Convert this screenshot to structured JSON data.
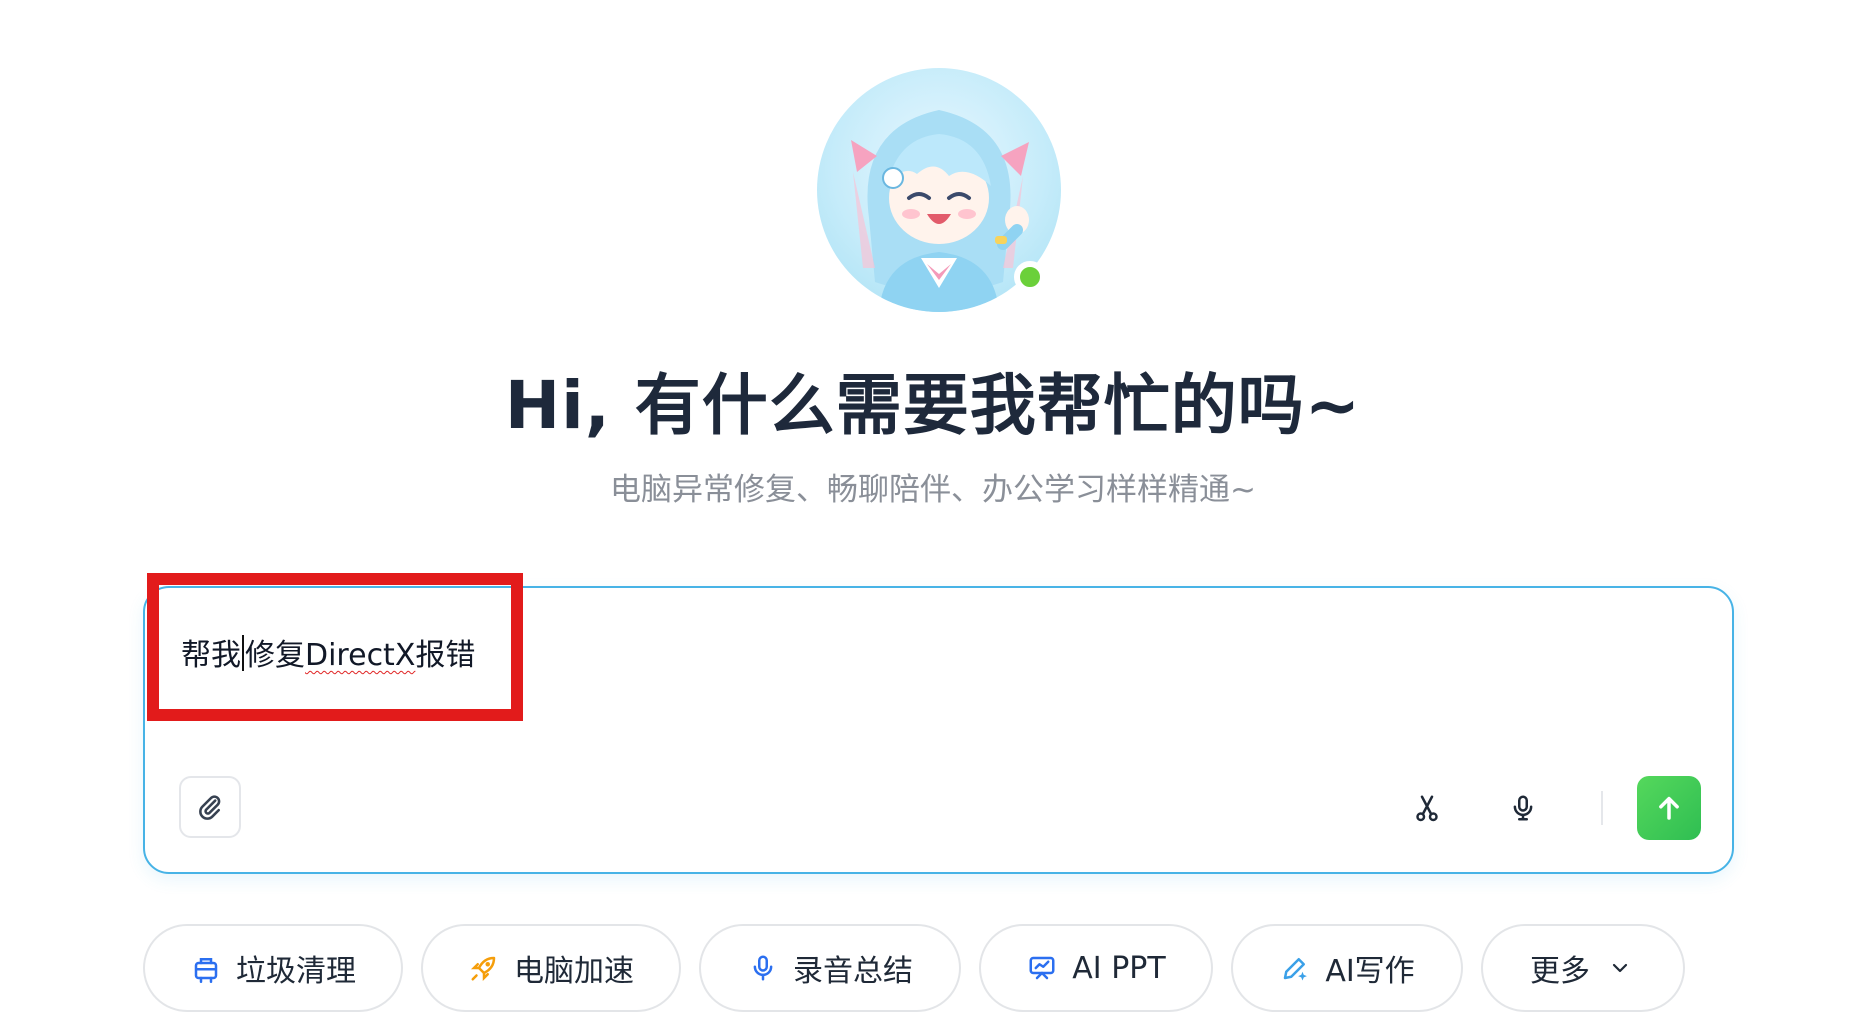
{
  "hero": {
    "title": "Hi, 有什么需要我帮忙的吗~",
    "subtitle": "电脑异常修复、畅聊陪伴、办公学习样样精通~",
    "status_color": "#6bd03a"
  },
  "input": {
    "before_caret": "帮我",
    "after_caret": "修复",
    "misspelled": "DirectX",
    "suffix": "报错"
  },
  "toolbar": {
    "attach_icon": "paperclip-icon",
    "scissors_icon": "scissors-icon",
    "mic_icon": "microphone-icon",
    "send_icon": "arrow-up-icon",
    "send_color": "#3fcb56"
  },
  "quick_actions": [
    {
      "label": "垃圾清理",
      "icon": "broom-icon"
    },
    {
      "label": "电脑加速",
      "icon": "rocket-icon"
    },
    {
      "label": "录音总结",
      "icon": "microphone-icon"
    },
    {
      "label": "AI PPT",
      "icon": "presentation-icon"
    },
    {
      "label": "AI写作",
      "icon": "pen-icon"
    },
    {
      "label": "更多",
      "icon": "chevron-down-icon"
    }
  ]
}
